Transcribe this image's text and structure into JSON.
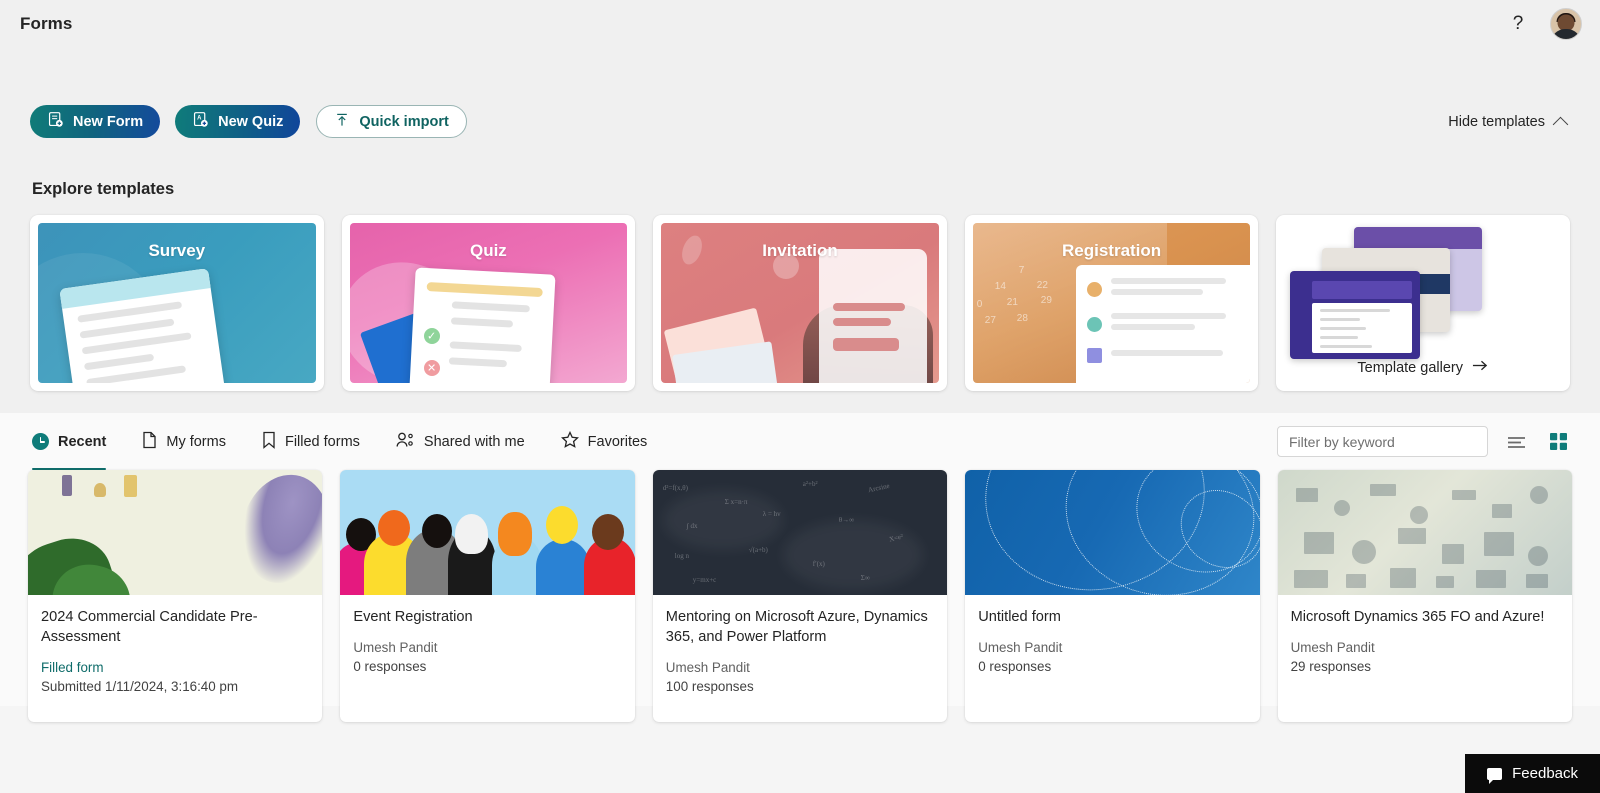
{
  "header": {
    "app_title": "Forms",
    "help_icon": "question-mark-icon",
    "avatar_label": "Umesh Pandit"
  },
  "actions": {
    "new_form": "New Form",
    "new_quiz": "New Quiz",
    "quick_import": "Quick import",
    "hide_templates": "Hide templates"
  },
  "templates": {
    "section_title": "Explore templates",
    "items": [
      {
        "label": "Survey"
      },
      {
        "label": "Quiz"
      },
      {
        "label": "Invitation"
      },
      {
        "label": "Registration"
      }
    ],
    "gallery_label": "Template gallery"
  },
  "tabs": [
    {
      "label": "Recent",
      "icon": "clock-icon",
      "active": true
    },
    {
      "label": "My forms",
      "icon": "document-icon",
      "active": false
    },
    {
      "label": "Filled forms",
      "icon": "bookmark-icon",
      "active": false
    },
    {
      "label": "Shared with me",
      "icon": "people-icon",
      "active": false
    },
    {
      "label": "Favorites",
      "icon": "star-icon",
      "active": false
    }
  ],
  "toolbar": {
    "filter_placeholder": "Filter by keyword",
    "filter_value": "",
    "sort_icon": "sort-lines-icon",
    "grid_view_icon": "grid-view-icon",
    "accent_color": "#0f7c7a"
  },
  "forms": [
    {
      "title": "2024 Commercial Candidate Pre-Assessment",
      "badge": "Filled form",
      "sub": "Submitted 1/11/2024, 3:16:40 pm",
      "owner": "",
      "responses": ""
    },
    {
      "title": "Event Registration",
      "badge": "",
      "sub": "",
      "owner": "Umesh Pandit",
      "responses": "0 responses"
    },
    {
      "title": "Mentoring on Microsoft Azure, Dynamics 365, and Power Platform",
      "badge": "",
      "sub": "",
      "owner": "Umesh Pandit",
      "responses": "100 responses"
    },
    {
      "title": "Untitled form",
      "badge": "",
      "sub": "",
      "owner": "Umesh Pandit",
      "responses": "0 responses"
    },
    {
      "title": "Microsoft Dynamics 365 FO and Azure!",
      "badge": "",
      "sub": "",
      "owner": "Umesh Pandit",
      "responses": "29 responses"
    }
  ],
  "feedback": {
    "label": "Feedback",
    "icon": "chat-bubble-icon"
  }
}
